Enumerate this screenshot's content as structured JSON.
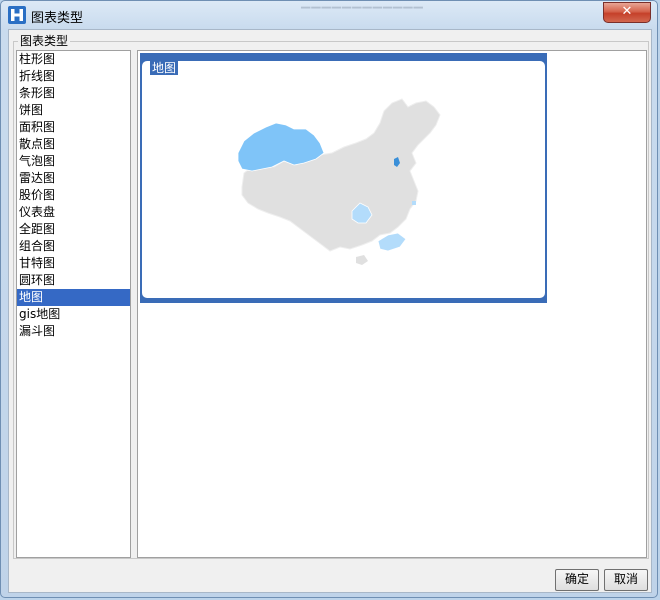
{
  "window": {
    "title": "图表类型",
    "close_label": "✕"
  },
  "groupbox": {
    "legend": "图表类型"
  },
  "chart_types": [
    {
      "label": "柱形图"
    },
    {
      "label": "折线图"
    },
    {
      "label": "条形图"
    },
    {
      "label": "饼图"
    },
    {
      "label": "面积图"
    },
    {
      "label": "散点图"
    },
    {
      "label": "气泡图"
    },
    {
      "label": "雷达图"
    },
    {
      "label": "股价图"
    },
    {
      "label": "仪表盘"
    },
    {
      "label": "全距图"
    },
    {
      "label": "组合图"
    },
    {
      "label": "甘特图"
    },
    {
      "label": "圆环图"
    },
    {
      "label": "地图",
      "selected": true
    },
    {
      "label": "gis地图"
    },
    {
      "label": "漏斗图"
    }
  ],
  "preview": {
    "card_label": "地图"
  },
  "buttons": {
    "ok": "确定",
    "cancel": "取消"
  },
  "colors": {
    "selection": "#3569c5",
    "card_border": "#3a6cb7",
    "map_base": "#e0e0e0",
    "map_highlight": "#7fc4f8",
    "map_light": "#b3dcfb"
  }
}
